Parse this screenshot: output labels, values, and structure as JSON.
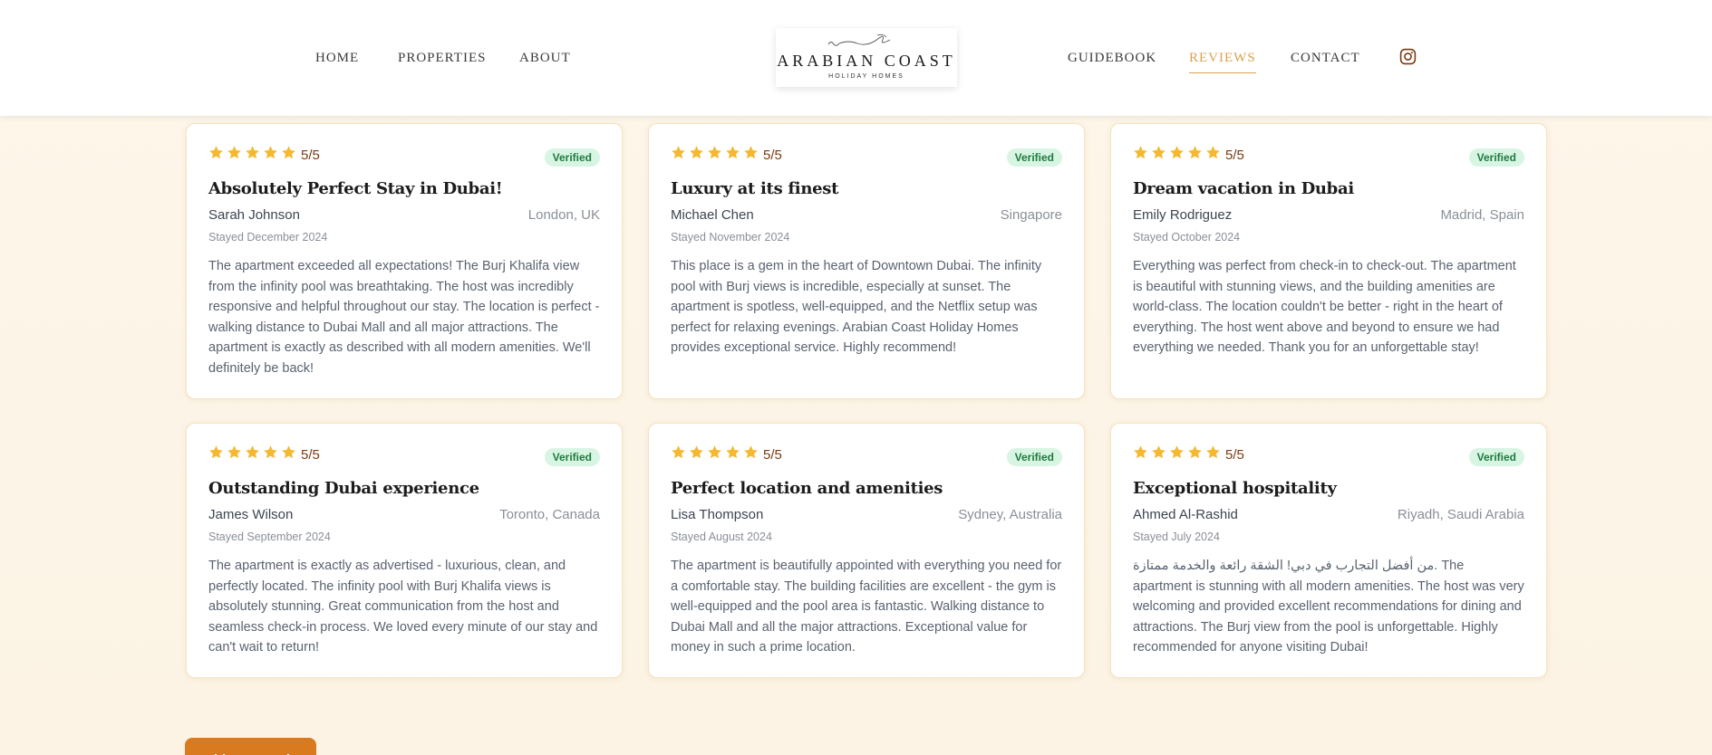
{
  "nav": {
    "home": "HOME",
    "properties": "PROPERTIES",
    "about": "ABOUT",
    "guidebook": "GUIDEBOOK",
    "reviews": "REVIEWS",
    "contact": "CONTACT",
    "instagram_icon": "instagram-icon"
  },
  "logo": {
    "main": "ARABIAN COAST",
    "sub": "HOLIDAY HOMES"
  },
  "colors": {
    "accent": "#d9a24e",
    "button": "#d97a1e",
    "star": "#f5b82e",
    "verified_bg": "#d8f5e3",
    "verified_text": "#1f7a3f"
  },
  "reviews": [
    {
      "rating": "5/5",
      "stars": 5,
      "badge": "Verified",
      "title": "Absolutely Perfect Stay in Dubai!",
      "name": "Sarah Johnson",
      "location": "London, UK",
      "stayed": "Stayed December 2024",
      "text": "The apartment exceeded all expectations! The Burj Khalifa view from the infinity pool was breathtaking. The host was incredibly responsive and helpful throughout our stay. The location is perfect - walking distance to Dubai Mall and all major attractions. The apartment is exactly as described with all modern amenities. We'll definitely be back!"
    },
    {
      "rating": "5/5",
      "stars": 5,
      "badge": "Verified",
      "title": "Luxury at its finest",
      "name": "Michael Chen",
      "location": "Singapore",
      "stayed": "Stayed November 2024",
      "text": "This place is a gem in the heart of Downtown Dubai. The infinity pool with Burj views is incredible, especially at sunset. The apartment is spotless, well-equipped, and the Netflix setup was perfect for relaxing evenings. Arabian Coast Holiday Homes provides exceptional service. Highly recommend!"
    },
    {
      "rating": "5/5",
      "stars": 5,
      "badge": "Verified",
      "title": "Dream vacation in Dubai",
      "name": "Emily Rodriguez",
      "location": "Madrid, Spain",
      "stayed": "Stayed October 2024",
      "text": "Everything was perfect from check-in to check-out. The apartment is beautiful with stunning views, and the building amenities are world-class. The location couldn't be better - right in the heart of everything. The host went above and beyond to ensure we had everything we needed. Thank you for an unforgettable stay!"
    },
    {
      "rating": "5/5",
      "stars": 5,
      "badge": "Verified",
      "title": "Outstanding Dubai experience",
      "name": "James Wilson",
      "location": "Toronto, Canada",
      "stayed": "Stayed September 2024",
      "text": "The apartment is exactly as advertised - luxurious, clean, and perfectly located. The infinity pool with Burj Khalifa views is absolutely stunning. Great communication from the host and seamless check-in process. We loved every minute of our stay and can't wait to return!"
    },
    {
      "rating": "5/5",
      "stars": 5,
      "badge": "Verified",
      "title": "Perfect location and amenities",
      "name": "Lisa Thompson",
      "location": "Sydney, Australia",
      "stayed": "Stayed August 2024",
      "text": "The apartment is beautifully appointed with everything you need for a comfortable stay. The building facilities are excellent - the gym is well-equipped and the pool area is fantastic. Walking distance to Dubai Mall and all the major attractions. Exceptional value for money in such a prime location."
    },
    {
      "rating": "5/5",
      "stars": 5,
      "badge": "Verified",
      "title": "Exceptional hospitality",
      "name": "Ahmed Al-Rashid",
      "location": "Riyadh, Saudi Arabia",
      "stayed": "Stayed July 2024",
      "text": "من أفضل التجارب في دبي! الشقة رائعة والخدمة ممتازة. The apartment is stunning with all modern amenities. The host was very welcoming and provided excellent recommendations for dining and attractions. The Burj view from the pool is unforgettable. Highly recommended for anyone visiting Dubai!"
    }
  ],
  "add_review_button": "Add New Review"
}
